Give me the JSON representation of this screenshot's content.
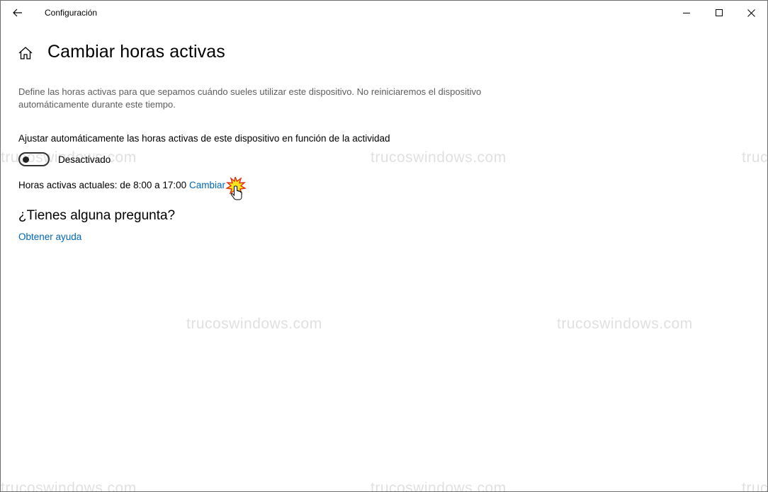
{
  "window": {
    "title": "Configuración",
    "controls": [
      "minimize-icon",
      "maximize-icon",
      "close-icon"
    ]
  },
  "page": {
    "title": "Cambiar horas activas",
    "description": "Define las horas activas para que sepamos cuándo sueles utilizar este dispositivo. No reiniciaremos el dispositivo automáticamente durante este tiempo."
  },
  "auto_adjust": {
    "label": "Ajustar automáticamente las horas activas de este dispositivo en función de la actividad",
    "toggle_state_label": "Desactivado",
    "toggle_on": false
  },
  "active_hours": {
    "label": "Horas activas actuales: de 8:00 a 17:00",
    "change_link": "Cambiar"
  },
  "help": {
    "heading": "¿Tienes alguna pregunta?",
    "link": "Obtener ayuda"
  },
  "watermark": "trucoswindows.com",
  "colors": {
    "link": "#0067b8",
    "description": "#5d5d5d",
    "border": "#6d6d6d"
  }
}
